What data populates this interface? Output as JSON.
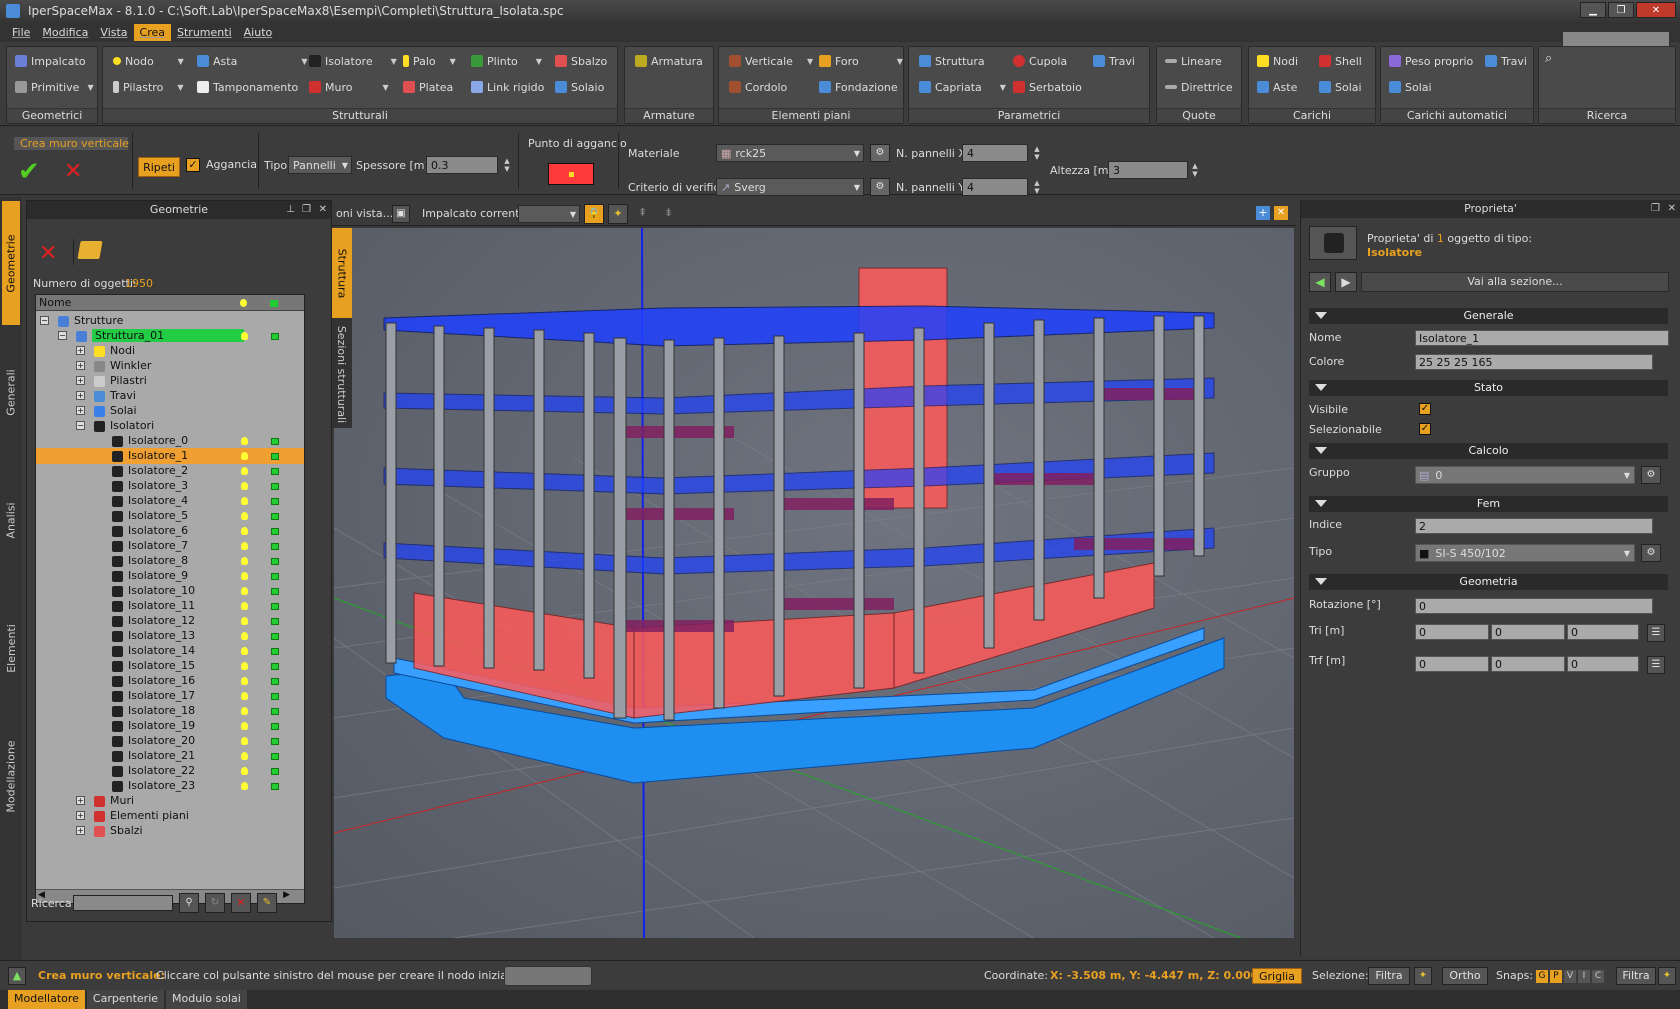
{
  "window": {
    "title": "IperSpaceMax - 8.1.0 - C:\\Soft.Lab\\IperSpaceMax8\\Esempi\\Completi\\Struttura_Isolata.spc"
  },
  "menu": [
    "File",
    "Modifica",
    "Vista",
    "Crea",
    "Strumenti",
    "Aiuto"
  ],
  "menu_active": "Crea",
  "ribbon": {
    "geometrici": {
      "label": "Geometrici",
      "items": [
        "Impalcato",
        "Primitive"
      ]
    },
    "strutturali": {
      "label": "Strutturali",
      "items": [
        "Nodo",
        "Asta",
        "Isolatore",
        "Palo",
        "Plinto",
        "Sbalzo",
        "Pilastro",
        "Tamponamento",
        "Muro",
        "Platea",
        "Link rigido",
        "Solaio"
      ]
    },
    "armature": {
      "label": "Armature",
      "items": [
        "Armatura"
      ]
    },
    "elementi_piani": {
      "label": "Elementi piani",
      "items": [
        "Verticale",
        "Foro",
        "Cordolo",
        "Fondazione"
      ]
    },
    "parametrici": {
      "label": "Parametrici",
      "items": [
        "Struttura",
        "Cupola",
        "Travi",
        "Capriata",
        "Serbatoio"
      ]
    },
    "quote": {
      "label": "Quote",
      "items": [
        "Lineare",
        "Direttrice"
      ]
    },
    "carichi": {
      "label": "Carichi",
      "items": [
        "Nodi",
        "Shell",
        "Aste",
        "Solai"
      ]
    },
    "carichi_automatici": {
      "label": "Carichi automatici",
      "items": [
        "Peso proprio",
        "Travi",
        "Solai"
      ]
    },
    "ricerca": {
      "label": "Ricerca"
    }
  },
  "command": {
    "name": "Crea muro verticale",
    "ripeti": "Ripeti",
    "aggancia": "Aggancia",
    "tipo_label": "Tipo",
    "tipo_value": "Pannelli",
    "spessore_label": "Spessore [m]",
    "spessore_value": "0.3",
    "punto_label": "Punto di aggancio",
    "materiale_label": "Materiale",
    "materiale_value": "rck25",
    "criterio_label": "Criterio di verifica",
    "criterio_value": "Sverg",
    "npx_label": "N. pannelli X",
    "npx_value": "4",
    "npy_label": "N. pannelli Y",
    "npy_value": "4",
    "altezza_label": "Altezza [m]",
    "altezza_value": "3"
  },
  "left_tabs": [
    "Geometrie",
    "Generali",
    "Analisi",
    "Elementi",
    "Modellazione"
  ],
  "geometrie_panel": {
    "title": "Geometrie",
    "count_label": "Numero di oggetti:",
    "count_value": "1950",
    "col_name": "Nome",
    "search_label": "Ricerca:"
  },
  "tree": {
    "root": "Strutture",
    "struttura": "Struttura_01",
    "groups_top": [
      "Nodi",
      "Winkler",
      "Pilastri",
      "Travi",
      "Solai"
    ],
    "isolatori": "Isolatori",
    "isolatore_items": [
      "Isolatore_0",
      "Isolatore_1",
      "Isolatore_2",
      "Isolatore_3",
      "Isolatore_4",
      "Isolatore_5",
      "Isolatore_6",
      "Isolatore_7",
      "Isolatore_8",
      "Isolatore_9",
      "Isolatore_10",
      "Isolatore_11",
      "Isolatore_12",
      "Isolatore_13",
      "Isolatore_14",
      "Isolatore_15",
      "Isolatore_16",
      "Isolatore_17",
      "Isolatore_18",
      "Isolatore_19",
      "Isolatore_20",
      "Isolatore_21",
      "Isolatore_22",
      "Isolatore_23"
    ],
    "selected": "Isolatore_1",
    "groups_bottom": [
      "Muri",
      "Elementi piani",
      "Sbalzi"
    ]
  },
  "side_tabs": [
    "Struttura",
    "Sezioni strutturali"
  ],
  "viewport_toolbar": {
    "view_label": "oni vista...",
    "impalcato_label": "Impalcato corrente:"
  },
  "properties": {
    "title": "Proprieta'",
    "header_prefix": "Proprieta' di",
    "header_count": "1",
    "header_suffix": "oggetto di tipo:",
    "type": "Isolatore",
    "goto": "Vai alla sezione...",
    "sections": {
      "generale": "Generale",
      "stato": "Stato",
      "calcolo": "Calcolo",
      "fem": "Fem",
      "geometria": "Geometria"
    },
    "nome_label": "Nome",
    "nome_value": "Isolatore_1",
    "colore_label": "Colore",
    "colore_value": "25 25 25 165",
    "visibile_label": "Visibile",
    "selezionabile_label": "Selezionabile",
    "gruppo_label": "Gruppo",
    "gruppo_value": "0",
    "indice_label": "Indice",
    "indice_value": "2",
    "tipo_label": "Tipo",
    "tipo_value": "SI-S 450/102",
    "rotazione_label": "Rotazione [°]",
    "rotazione_value": "0",
    "tri_label": "Tri [m]",
    "tri_values": [
      "0",
      "0",
      "0"
    ],
    "trf_label": "Trf [m]",
    "trf_values": [
      "0",
      "0",
      "0"
    ]
  },
  "status": {
    "cmd": "Crea muro verticale:",
    "msg": "Cliccare col pulsante sinistro del mouse per creare il nodo iniziale",
    "coord_label": "Coordinate:",
    "coord_value": "X: -3.508 m, Y: -4.447 m, Z: 0.000 m",
    "griglia": "Griglia",
    "selezione": "Selezione:",
    "filtra": "Filtra",
    "ortho": "Ortho",
    "snaps": "Snaps:",
    "snap_letters": [
      "G",
      "P",
      "V",
      "I",
      "C"
    ]
  },
  "bottom_tabs": [
    "Modellatore",
    "Carpenterie",
    "Modulo solai"
  ],
  "colors": {
    "accent": "#e8a020",
    "wall_red": "#ff4a4a",
    "slab_blue": "#2255ff"
  }
}
